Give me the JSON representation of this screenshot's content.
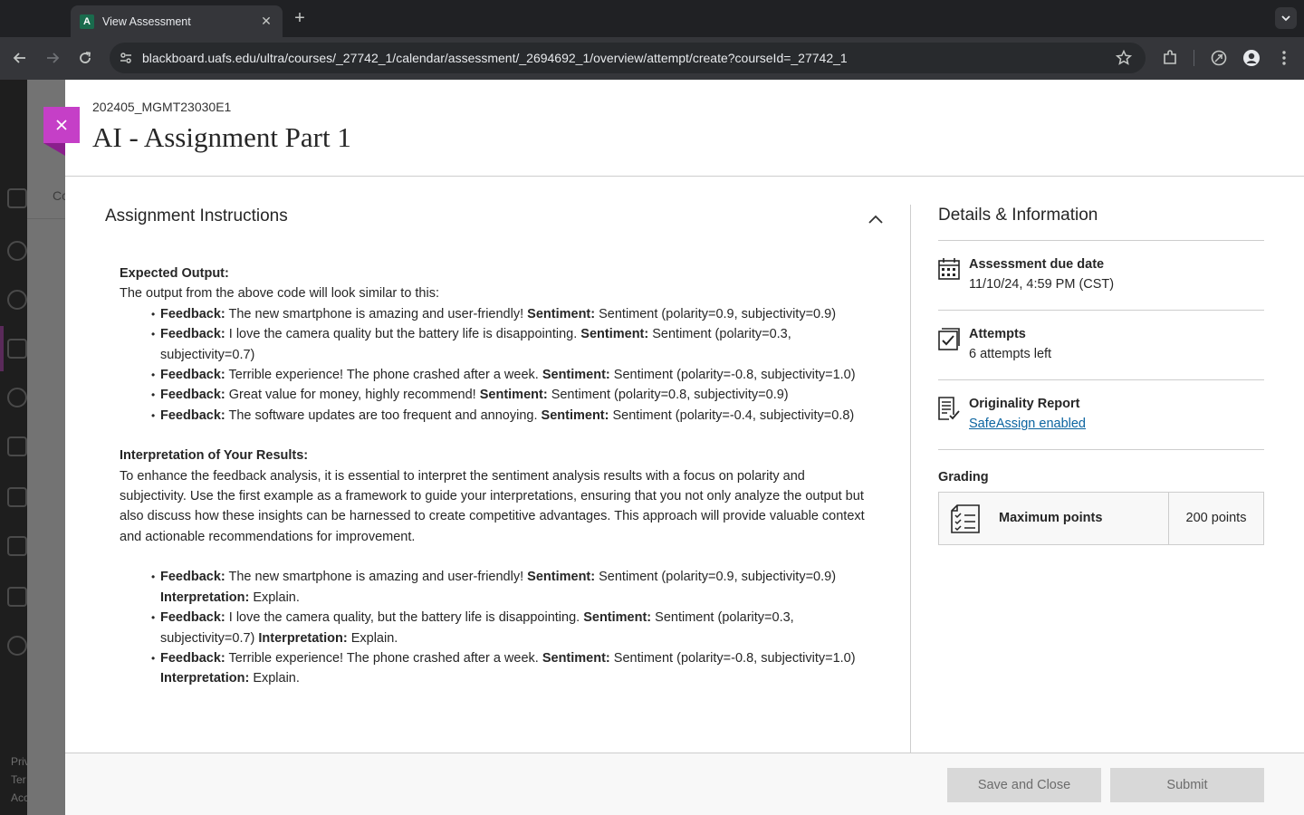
{
  "browser": {
    "tab_title": "View Assessment",
    "url": "blackboard.uafs.edu/ultra/courses/_27742_1/calendar/assessment/_2694692_1/overview/attempt/create?courseId=_27742_1"
  },
  "underlay": {
    "col_fragment": "Co",
    "footer": [
      "Priv",
      "Ter",
      "Acc"
    ]
  },
  "header": {
    "course_code": "202405_MGMT23030E1",
    "title": "AI - Assignment Part 1"
  },
  "instructions": {
    "heading": "Assignment Instructions",
    "expected_output_label": "Expected Output:",
    "expected_output_text": "The output from the above code will look similar to this:",
    "labels": {
      "feedback": "Feedback:",
      "sentiment": "Sentiment:",
      "interpretation": "Interpretation:"
    },
    "output_items": [
      {
        "feedback": "The new smartphone is amazing and user-friendly!",
        "sentiment": "Sentiment (polarity=0.9, subjectivity=0.9)"
      },
      {
        "feedback": "I love the camera quality but the battery life is disappointing.",
        "sentiment": "Sentiment (polarity=0.3, subjectivity=0.7)"
      },
      {
        "feedback": "Terrible experience! The phone crashed after a week.",
        "sentiment": "Sentiment (polarity=-0.8, subjectivity=1.0)"
      },
      {
        "feedback": "Great value for money, highly recommend!",
        "sentiment": "Sentiment (polarity=0.8, subjectivity=0.9)"
      },
      {
        "feedback": "The software updates are too frequent and annoying.",
        "sentiment": "Sentiment (polarity=-0.4, subjectivity=0.8)"
      }
    ],
    "interpretation_label": "Interpretation of Your Results:",
    "interpretation_text": "To enhance the feedback analysis, it is essential to interpret the sentiment analysis results with a focus on polarity and subjectivity. Use the first example as a framework to guide your interpretations, ensuring that you not only analyze the output but also discuss how these insights can be harnessed to create competitive advantages. This approach will provide valuable context and actionable recommendations for improvement.",
    "interpretation_items": [
      {
        "feedback": "The new smartphone is amazing and user-friendly!",
        "sentiment": "Sentiment (polarity=0.9, subjectivity=0.9)",
        "interpretation": "Explain."
      },
      {
        "feedback": "I love the camera quality, but the battery life is disappointing.",
        "sentiment": "Sentiment (polarity=0.3, subjectivity=0.7)",
        "interpretation": "Explain."
      },
      {
        "feedback": "Terrible experience! The phone crashed after a week.",
        "sentiment": "Sentiment (polarity=-0.8, subjectivity=1.0)",
        "interpretation": "Explain."
      }
    ]
  },
  "details": {
    "title": "Details & Information",
    "due_date_label": "Assessment due date",
    "due_date_value": "11/10/24, 4:59 PM (CST)",
    "attempts_label": "Attempts",
    "attempts_value": "6 attempts left",
    "originality_label": "Originality Report",
    "originality_link": "SafeAssign enabled",
    "grading_label": "Grading",
    "max_points_label": "Maximum points",
    "max_points_value": "200 points"
  },
  "footer": {
    "save_label": "Save and Close",
    "submit_label": "Submit"
  },
  "colors": {
    "close_accent": "#c53fc7",
    "link": "#0b64a0",
    "disabled_button": "#d8d8d8"
  }
}
